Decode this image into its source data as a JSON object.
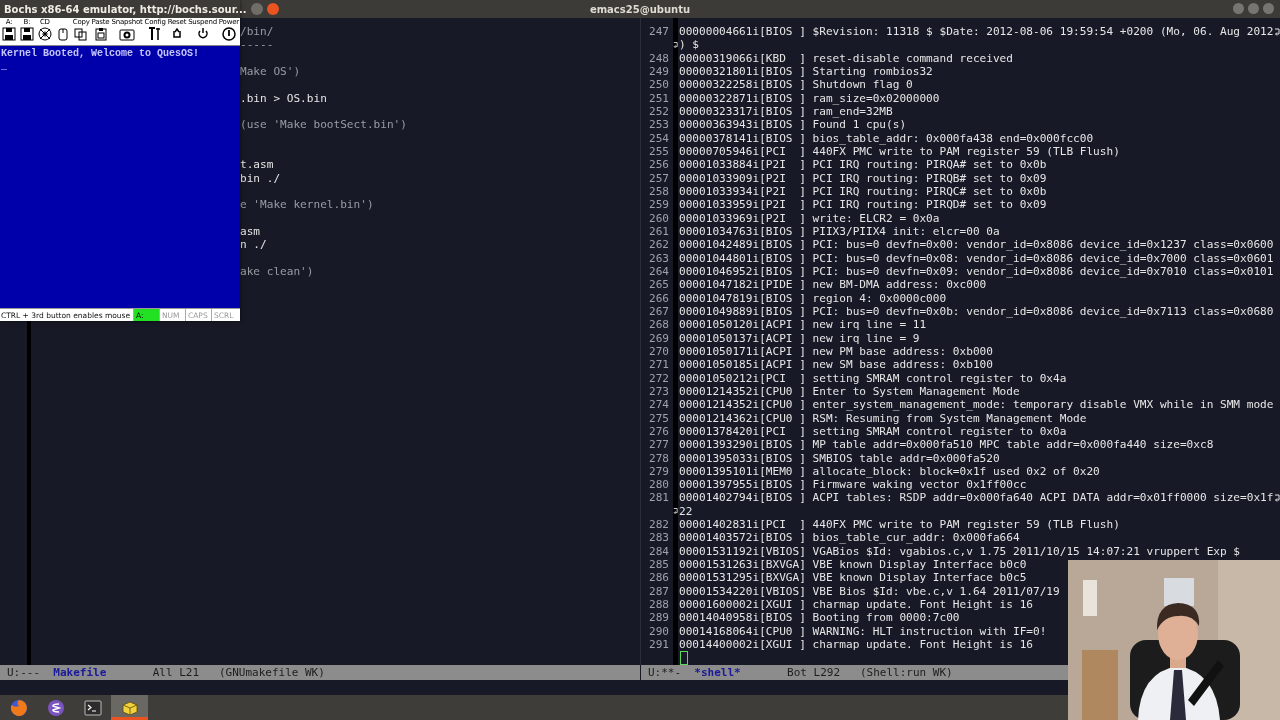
{
  "title_bar": {
    "title": "emacs25@ubuntu"
  },
  "bochs": {
    "title": "Bochs x86-64 emulator, http://bochs.sour...",
    "toolbar": [
      {
        "kind": "floppy",
        "label": "A:"
      },
      {
        "kind": "floppy",
        "label": "B:"
      },
      {
        "kind": "cdrom",
        "label": "CD"
      },
      {
        "kind": "mouse"
      },
      {
        "kind": "copy",
        "label": "Copy"
      },
      {
        "kind": "paste",
        "label": "Paste"
      },
      {
        "kind": "snapshot",
        "label": "Snapshot"
      },
      {
        "kind": "config",
        "label": "Config"
      },
      {
        "kind": "reset",
        "label": "Reset"
      },
      {
        "kind": "suspend",
        "label": "Suspend"
      },
      {
        "kind": "power",
        "label": "Power"
      }
    ],
    "screen_lines": [
      "Kernel Booted, Welcome to QuesOS!",
      "_"
    ],
    "status_text": "CTRL + 3rd button enables mouse",
    "indicators": [
      {
        "label": "A:",
        "on": true
      },
      {
        "label": "NUM",
        "on": false
      },
      {
        "label": "CAPS",
        "on": false
      },
      {
        "label": "SCRL",
        "on": false
      }
    ]
  },
  "left_pane": {
    "lines": [
      {
        "kind": "comment",
        "text": "/bin/"
      },
      {
        "kind": "comment",
        "text": "-----"
      },
      {
        "kind": "blank"
      },
      {
        "kind": "comment",
        "text": "Make OS')"
      },
      {
        "kind": "blank"
      },
      {
        "kind": "code",
        "text": ".bin > OS.bin"
      },
      {
        "kind": "blank"
      },
      {
        "kind": "comment",
        "text": " (use 'Make bootSect.bin')"
      },
      {
        "kind": "blank"
      },
      {
        "kind": "blank"
      },
      {
        "kind": "code",
        "text": "t.asm"
      },
      {
        "kind": "code",
        "text": "bin ./"
      },
      {
        "kind": "blank"
      },
      {
        "kind": "comment",
        "text": "e 'Make kernel.bin')"
      },
      {
        "kind": "blank"
      },
      {
        "kind": "code",
        "text": "asm"
      },
      {
        "kind": "code",
        "text": "n ./"
      },
      {
        "kind": "blank"
      },
      {
        "kind": "comment",
        "text": "ake clean')"
      }
    ],
    "mode_line": {
      "status": "U:---",
      "buffer": "Makefile",
      "position": "All L21",
      "mode": "(GNUmakefile WK)"
    }
  },
  "right_pane": {
    "lines": [
      {
        "kind": "numbered",
        "number": "247",
        "text": "00000004661i[BIOS ] $Revision: 11318 $ $Date: 2012-08-06 19:59:54 +0200 (Mo, 06. Aug 2012",
        "wrapped": true
      },
      {
        "kind": "continuation",
        "text": ") $"
      },
      {
        "kind": "numbered",
        "number": "248",
        "text": "00000319066i[KBD  ] reset-disable command received"
      },
      {
        "kind": "numbered",
        "number": "249",
        "text": "00000321801i[BIOS ] Starting rombios32"
      },
      {
        "kind": "numbered",
        "number": "250",
        "text": "00000322258i[BIOS ] Shutdown flag 0"
      },
      {
        "kind": "numbered",
        "number": "251",
        "text": "00000322871i[BIOS ] ram_size=0x02000000"
      },
      {
        "kind": "numbered",
        "number": "252",
        "text": "00000323317i[BIOS ] ram_end=32MB"
      },
      {
        "kind": "numbered",
        "number": "253",
        "text": "00000363943i[BIOS ] Found 1 cpu(s)"
      },
      {
        "kind": "numbered",
        "number": "254",
        "text": "00000378141i[BIOS ] bios_table_addr: 0x000fa438 end=0x000fcc00"
      },
      {
        "kind": "numbered",
        "number": "255",
        "text": "00000705946i[PCI  ] 440FX PMC write to PAM register 59 (TLB Flush)"
      },
      {
        "kind": "numbered",
        "number": "256",
        "text": "00001033884i[P2I  ] PCI IRQ routing: PIRQA# set to 0x0b"
      },
      {
        "kind": "numbered",
        "number": "257",
        "text": "00001033909i[P2I  ] PCI IRQ routing: PIRQB# set to 0x09"
      },
      {
        "kind": "numbered",
        "number": "258",
        "text": "00001033934i[P2I  ] PCI IRQ routing: PIRQC# set to 0x0b"
      },
      {
        "kind": "numbered",
        "number": "259",
        "text": "00001033959i[P2I  ] PCI IRQ routing: PIRQD# set to 0x09"
      },
      {
        "kind": "numbered",
        "number": "260",
        "text": "00001033969i[P2I  ] write: ELCR2 = 0x0a"
      },
      {
        "kind": "numbered",
        "number": "261",
        "text": "00001034763i[BIOS ] PIIX3/PIIX4 init: elcr=00 0a"
      },
      {
        "kind": "numbered",
        "number": "262",
        "text": "00001042489i[BIOS ] PCI: bus=0 devfn=0x00: vendor_id=0x8086 device_id=0x1237 class=0x0600"
      },
      {
        "kind": "numbered",
        "number": "263",
        "text": "00001044801i[BIOS ] PCI: bus=0 devfn=0x08: vendor_id=0x8086 device_id=0x7000 class=0x0601"
      },
      {
        "kind": "numbered",
        "number": "264",
        "text": "00001046952i[BIOS ] PCI: bus=0 devfn=0x09: vendor_id=0x8086 device_id=0x7010 class=0x0101"
      },
      {
        "kind": "numbered",
        "number": "265",
        "text": "00001047182i[PIDE ] new BM-DMA address: 0xc000"
      },
      {
        "kind": "numbered",
        "number": "266",
        "text": "00001047819i[BIOS ] region 4: 0x0000c000"
      },
      {
        "kind": "numbered",
        "number": "267",
        "text": "00001049889i[BIOS ] PCI: bus=0 devfn=0x0b: vendor_id=0x8086 device_id=0x7113 class=0x0680"
      },
      {
        "kind": "numbered",
        "number": "268",
        "text": "00001050120i[ACPI ] new irq line = 11"
      },
      {
        "kind": "numbered",
        "number": "269",
        "text": "00001050137i[ACPI ] new irq line = 9"
      },
      {
        "kind": "numbered",
        "number": "270",
        "text": "00001050171i[ACPI ] new PM base address: 0xb000"
      },
      {
        "kind": "numbered",
        "number": "271",
        "text": "00001050185i[ACPI ] new SM base address: 0xb100"
      },
      {
        "kind": "numbered",
        "number": "272",
        "text": "00001050212i[PCI  ] setting SMRAM control register to 0x4a"
      },
      {
        "kind": "numbered",
        "number": "273",
        "text": "00001214352i[CPU0 ] Enter to System Management Mode"
      },
      {
        "kind": "numbered",
        "number": "274",
        "text": "00001214352i[CPU0 ] enter_system_management_mode: temporary disable VMX while in SMM mode"
      },
      {
        "kind": "numbered",
        "number": "275",
        "text": "00001214362i[CPU0 ] RSM: Resuming from System Management Mode"
      },
      {
        "kind": "numbered",
        "number": "276",
        "text": "00001378420i[PCI  ] setting SMRAM control register to 0x0a"
      },
      {
        "kind": "numbered",
        "number": "277",
        "text": "00001393290i[BIOS ] MP table addr=0x000fa510 MPC table addr=0x000fa440 size=0xc8"
      },
      {
        "kind": "numbered",
        "number": "278",
        "text": "00001395033i[BIOS ] SMBIOS table addr=0x000fa520"
      },
      {
        "kind": "numbered",
        "number": "279",
        "text": "00001395101i[MEM0 ] allocate_block: block=0x1f used 0x2 of 0x20"
      },
      {
        "kind": "numbered",
        "number": "280",
        "text": "00001397955i[BIOS ] Firmware waking vector 0x1ff00cc"
      },
      {
        "kind": "numbered",
        "number": "281",
        "text": "00001402794i[BIOS ] ACPI tables: RSDP addr=0x000fa640 ACPI DATA addr=0x01ff0000 size=0x1f",
        "wrapped": true
      },
      {
        "kind": "continuation",
        "text": "22"
      },
      {
        "kind": "numbered",
        "number": "282",
        "text": "00001402831i[PCI  ] 440FX PMC write to PAM register 59 (TLB Flush)"
      },
      {
        "kind": "numbered",
        "number": "283",
        "text": "00001403572i[BIOS ] bios_table_cur_addr: 0x000fa664"
      },
      {
        "kind": "numbered",
        "number": "284",
        "text": "00001531192i[VBIOS] VGABios $Id: vgabios.c,v 1.75 2011/10/15 14:07:21 vruppert Exp $"
      },
      {
        "kind": "numbered",
        "number": "285",
        "text": "00001531263i[BXVGA] VBE known Display Interface b0c0"
      },
      {
        "kind": "numbered",
        "number": "286",
        "text": "00001531295i[BXVGA] VBE known Display Interface b0c5"
      },
      {
        "kind": "numbered",
        "number": "287",
        "text": "00001534220i[VBIOS] VBE Bios $Id: vbe.c,v 1.64 2011/07/19"
      },
      {
        "kind": "numbered",
        "number": "288",
        "text": "00001600002i[XGUI ] charmap update. Font Height is 16"
      },
      {
        "kind": "numbered",
        "number": "289",
        "text": "00014040958i[BIOS ] Booting from 0000:7c00"
      },
      {
        "kind": "numbered",
        "number": "290",
        "text": "00014168064i[CPU0 ] WARNING: HLT instruction with IF=0!"
      },
      {
        "kind": "numbered",
        "number": "291",
        "text": "00014400002i[XGUI ] charmap update. Font Height is 16"
      },
      {
        "kind": "cursor"
      }
    ],
    "mode_line": {
      "status": "U:**-",
      "buffer": "*shell*",
      "position": "Bot L292",
      "mode": "(Shell:run WK)"
    }
  },
  "taskbar": [
    {
      "kind": "browser",
      "selected": false
    },
    {
      "kind": "editor",
      "selected": false
    },
    {
      "kind": "terminal",
      "selected": false
    },
    {
      "kind": "emulator",
      "selected": true
    }
  ]
}
